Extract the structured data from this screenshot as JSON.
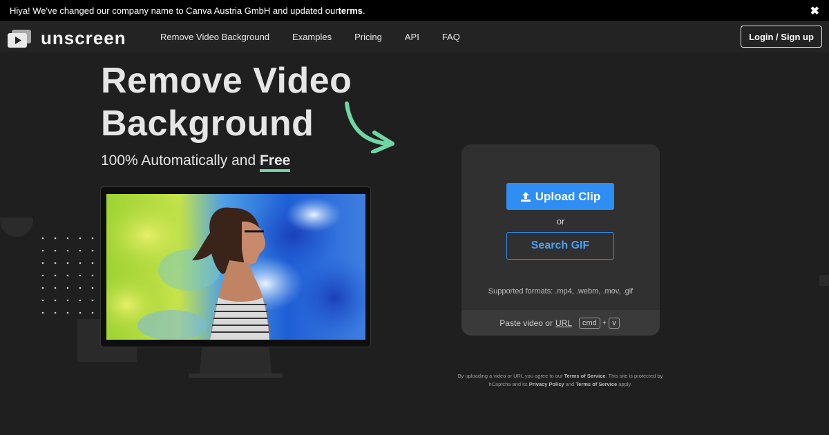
{
  "announcement": {
    "text": "Hiya! We've changed our company name to Canva Austria GmbH and updated our ",
    "link": "terms",
    "end": ".",
    "close": "✖"
  },
  "nav": {
    "logo_text": "unscreen",
    "links": [
      "Remove Video Background",
      "Examples",
      "Pricing",
      "API",
      "FAQ"
    ],
    "login": "Login / Sign up"
  },
  "hero": {
    "title_line1": "Remove Video",
    "title_line2": "Background",
    "subtitle": "100% Automatically and ",
    "subtitle_emphasis": "Free"
  },
  "upload": {
    "upload_label": "Upload Clip",
    "or": "or",
    "search_gif": "Search GIF",
    "formats": "Supported formats: .mp4, .webm, .mov, .gif",
    "paste_text": "Paste video or",
    "paste_url": "URL",
    "key_cmd": "cmd",
    "plus": "+",
    "key_v": "v"
  },
  "legal": {
    "p1": "By uploading a video or URL you agree to our ",
    "tos1": "Terms of Service",
    "p2": ". This site is protected by hCaptcha and its ",
    "privacy": "Privacy Policy",
    "p3": " and ",
    "tos2": "Terms of Service",
    "p4": " apply."
  },
  "colors": {
    "accent": "#2f8ef4",
    "highlight": "#6fd6a5",
    "background": "#1f1f1f"
  },
  "icons": [
    "logo-play-icon",
    "close-icon",
    "upload-icon",
    "curved-arrow-icon"
  ]
}
